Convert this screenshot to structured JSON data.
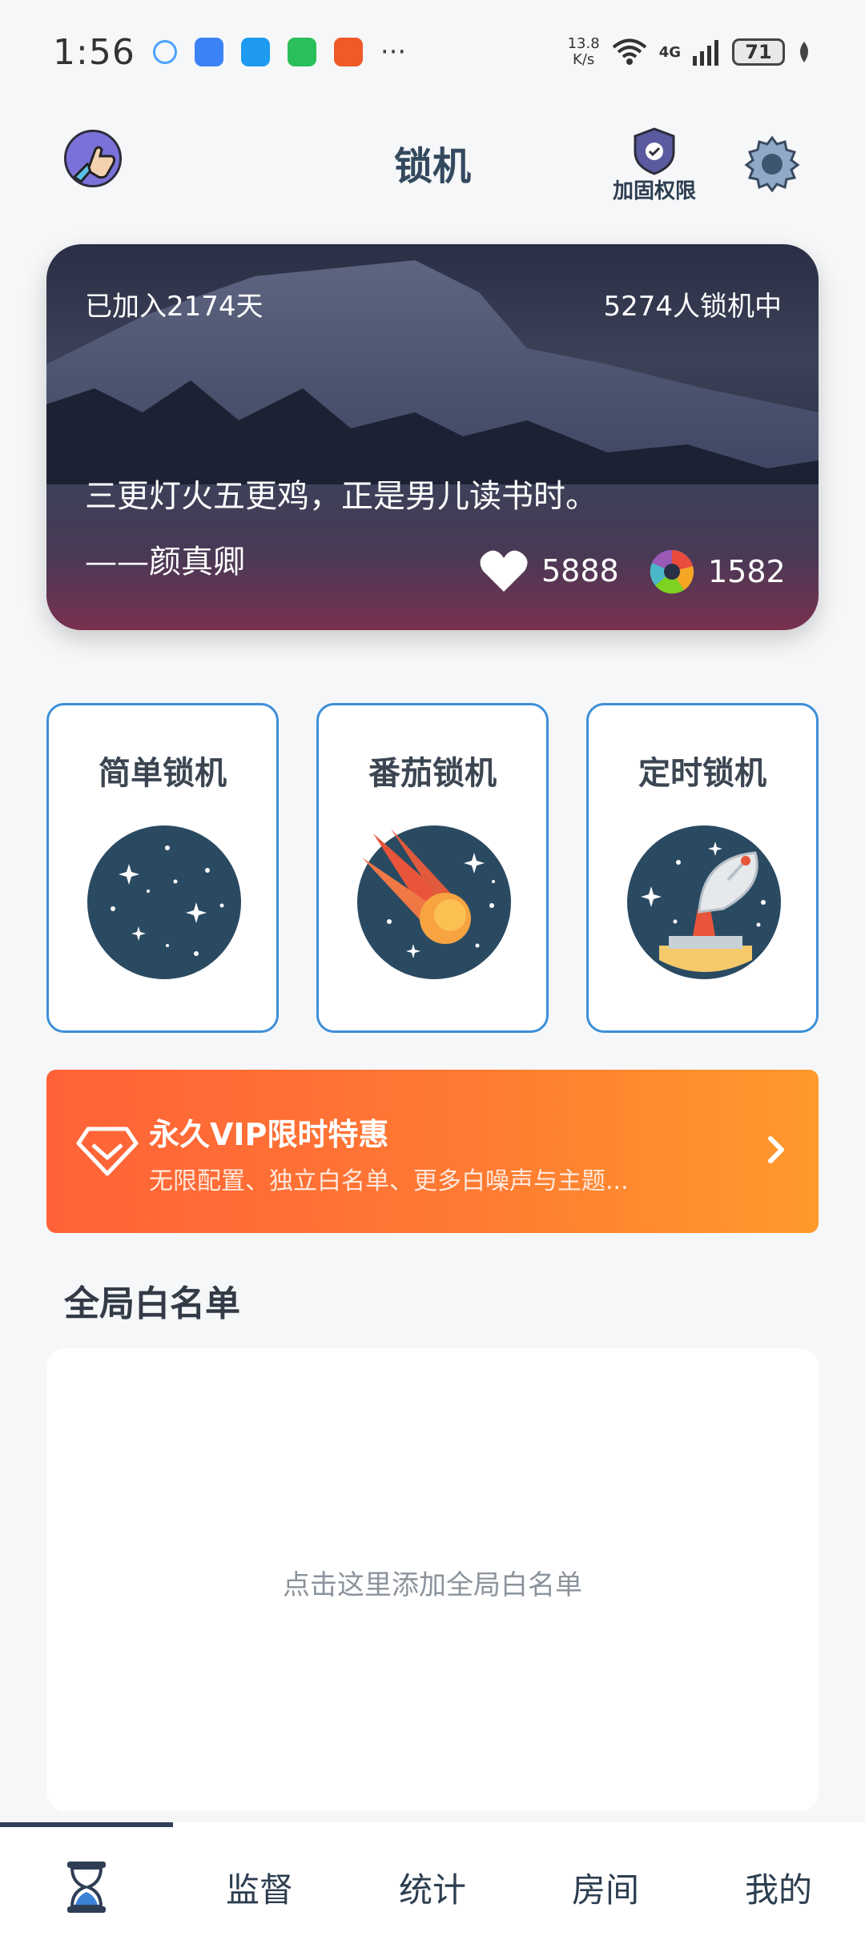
{
  "status_bar": {
    "time": "1:56",
    "more": "···",
    "net_speed_value": "13.8",
    "net_speed_unit": "K/s",
    "network": "4G",
    "battery": "71"
  },
  "header": {
    "title": "锁机",
    "shield_label": "加固权限"
  },
  "hero": {
    "days_joined": "已加入2174天",
    "online_count": "5274人锁机中",
    "quote": "三更灯火五更鸡，正是男儿读书时。",
    "author": "——颜真卿",
    "likes": "5888",
    "shares": "1582"
  },
  "modes": [
    {
      "label": "简单锁机",
      "icon": "starry-planet-icon"
    },
    {
      "label": "番茄锁机",
      "icon": "comet-icon"
    },
    {
      "label": "定时锁机",
      "icon": "satellite-dish-icon"
    }
  ],
  "vip": {
    "title": "永久VIP限时特惠",
    "subtitle": "无限配置、独立白名单、更多白噪声与主题..."
  },
  "whitelist": {
    "title": "全局白名单",
    "hint": "点击这里添加全局白名单"
  },
  "tabs": [
    {
      "icon": "hourglass-icon",
      "label": ""
    },
    {
      "label": "监督"
    },
    {
      "label": "统计"
    },
    {
      "label": "房间"
    },
    {
      "label": "我的"
    }
  ],
  "colors": {
    "accent_blue": "#3d8fd8",
    "vip_orange_start": "#ff6238",
    "vip_orange_end": "#ff9a2c",
    "planet_fill": "#2a4a62"
  }
}
